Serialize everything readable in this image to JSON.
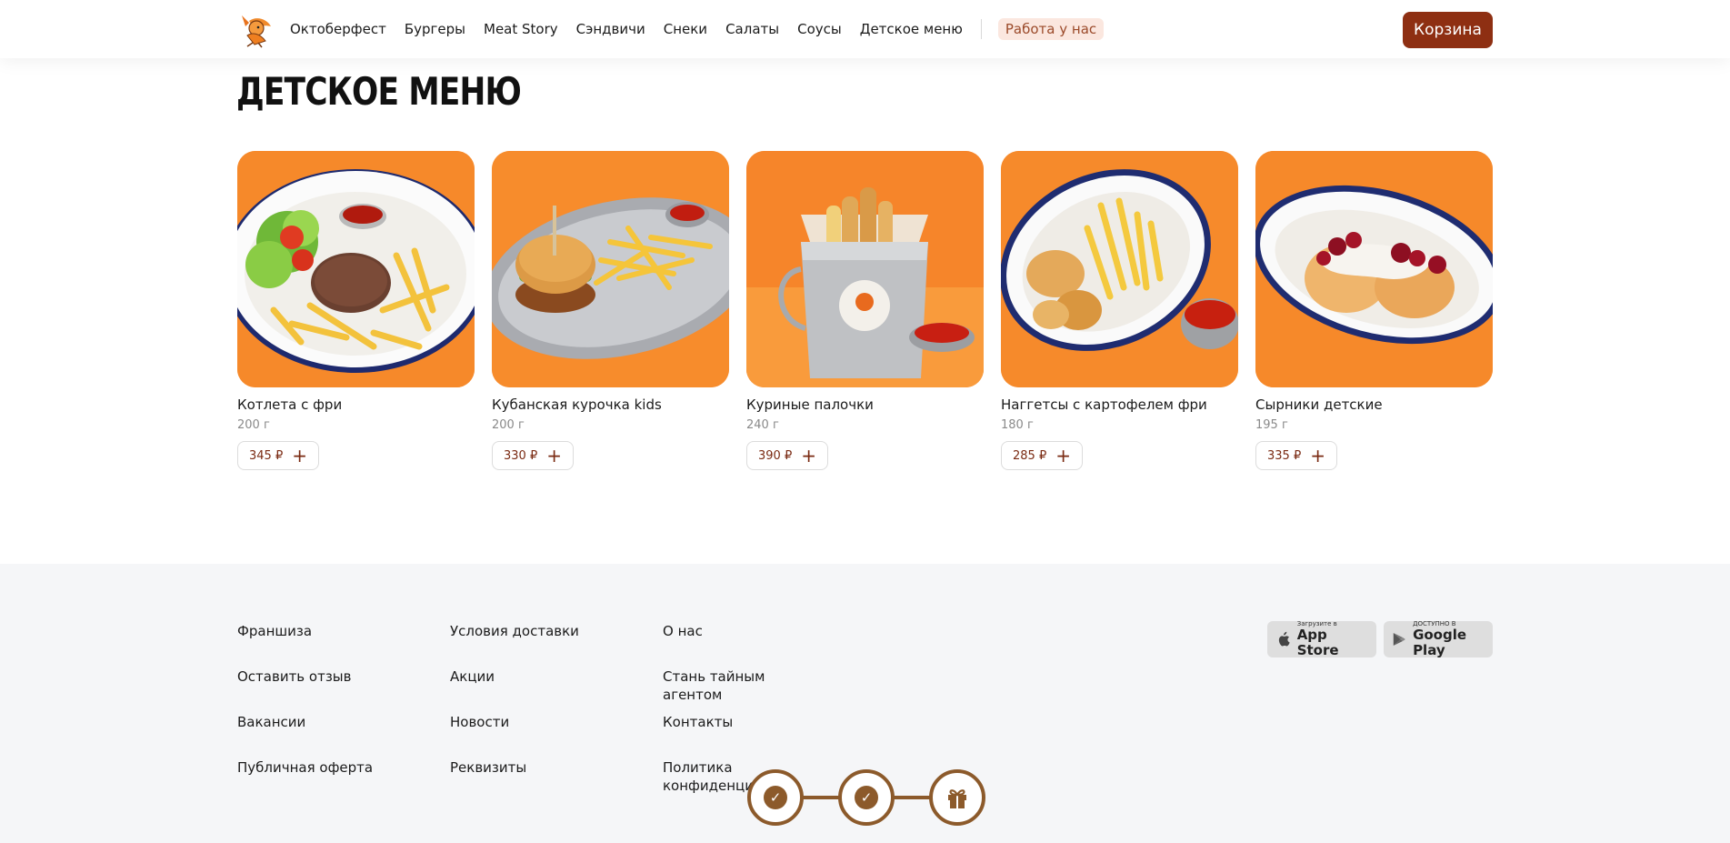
{
  "header": {
    "nav": [
      "Октоберфест",
      "Бургеры",
      "Meat Story",
      "Сэндвичи",
      "Снеки",
      "Салаты",
      "Соусы",
      "Детское меню"
    ],
    "job_chip": "Работа у нас",
    "cart_label": "Корзина",
    "logo_icon": "fox-logo-icon"
  },
  "section": {
    "title": "ДЕТСКОЕ МЕНЮ"
  },
  "products": [
    {
      "name": "Котлета с фри",
      "weight": "200 г",
      "price": "345 ₽"
    },
    {
      "name": "Кубанская курочка kids",
      "weight": "200 г",
      "price": "330 ₽"
    },
    {
      "name": "Куриные палочки",
      "weight": "240 г",
      "price": "390 ₽"
    },
    {
      "name": "Наггетсы с картофелем фри",
      "weight": "180 г",
      "price": "285 ₽"
    },
    {
      "name": "Сырники детские",
      "weight": "195 г",
      "price": "335 ₽"
    }
  ],
  "footer": {
    "col1": [
      "Франшиза",
      "Оставить отзыв",
      "Вакансии",
      "Публичная оферта"
    ],
    "col2": [
      "Условия доставки",
      "Акции",
      "Новости",
      "Реквизиты"
    ],
    "col3": [
      "О нас",
      "Стань тайным агентом",
      "Контакты",
      "Политика конфиденциа"
    ],
    "app_store": {
      "small": "Загрузите в",
      "big": "App Store"
    },
    "google_play": {
      "small": "ДОСТУПНО В",
      "big": "Google Play"
    }
  },
  "progress": {
    "steps": [
      "check-icon",
      "check-icon",
      "gift-icon"
    ]
  },
  "colors": {
    "brand": "#8e2f12",
    "accent_orange": "#f5892a",
    "progress": "#8c5a2b"
  }
}
